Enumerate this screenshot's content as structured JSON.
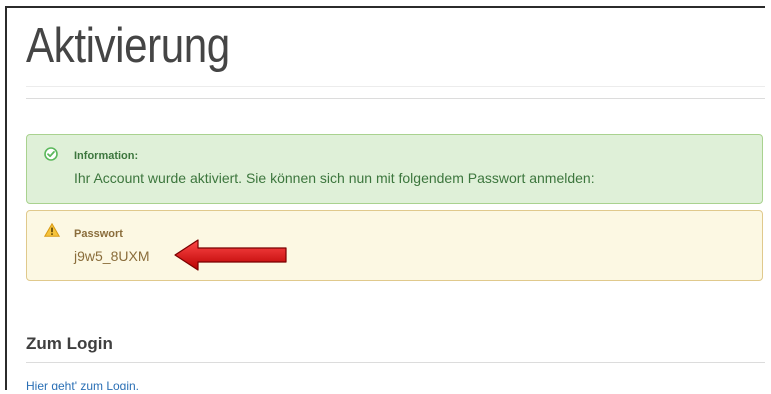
{
  "page": {
    "title": "Aktivierung"
  },
  "info_alert": {
    "icon": "check-circle-icon",
    "title": "Information:",
    "text": "Ihr Account wurde aktiviert. Sie können sich nun mit folgendem Passwort anmelden:",
    "colors": {
      "background": "#dff0d8",
      "border": "#a9d28f",
      "text": "#3c763d"
    }
  },
  "warning_alert": {
    "icon": "warning-triangle-icon",
    "title": "Passwort",
    "password": "j9w5_8UXM",
    "colors": {
      "background": "#fcf8e3",
      "border": "#e0c98c",
      "text": "#8a6d3b"
    }
  },
  "annotation": {
    "icon": "red-arrow-left-icon",
    "color": "#d40000"
  },
  "login": {
    "heading": "Zum Login",
    "link_text": "Hier geht' zum Login.",
    "link_color": "#2a6fb5"
  }
}
